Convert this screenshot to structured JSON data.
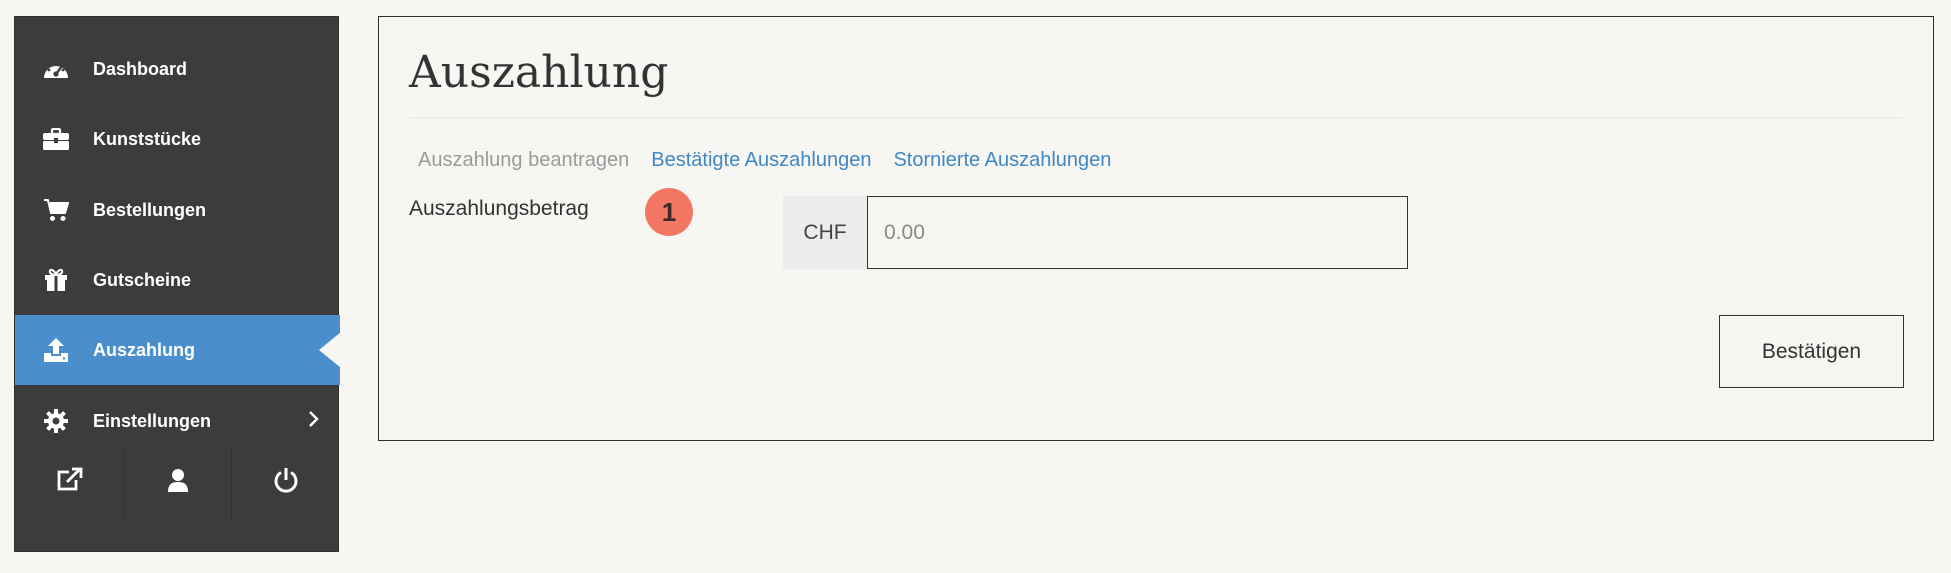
{
  "sidebar": {
    "items": [
      {
        "label": "Dashboard",
        "icon": "dashboard-icon"
      },
      {
        "label": "Kunststücke",
        "icon": "briefcase-icon"
      },
      {
        "label": "Bestellungen",
        "icon": "cart-icon"
      },
      {
        "label": "Gutscheine",
        "icon": "gift-icon"
      },
      {
        "label": "Auszahlung",
        "icon": "upload-icon",
        "active": true
      },
      {
        "label": "Einstellungen",
        "icon": "gear-icon"
      }
    ],
    "bottom_icons": [
      "external-link-icon",
      "user-icon",
      "power-icon"
    ]
  },
  "main": {
    "title": "Auszahlung",
    "tabs": [
      {
        "label": "Auszahlung beantragen",
        "state": "current"
      },
      {
        "label": "Bestätigte Auszahlungen",
        "state": "link"
      },
      {
        "label": "Stornierte Auszahlungen",
        "state": "link"
      }
    ],
    "form": {
      "amount_label": "Auszahlungsbetrag",
      "badge": "1",
      "currency": "CHF",
      "amount_placeholder": "0.00",
      "submit_label": "Bestätigen"
    }
  },
  "colors": {
    "sidebar_bg": "#3c3c3c",
    "active_bg": "#4a8fcb",
    "link": "#3f88c5",
    "badge": "#f47763",
    "page_bg": "#f7f6f3"
  }
}
